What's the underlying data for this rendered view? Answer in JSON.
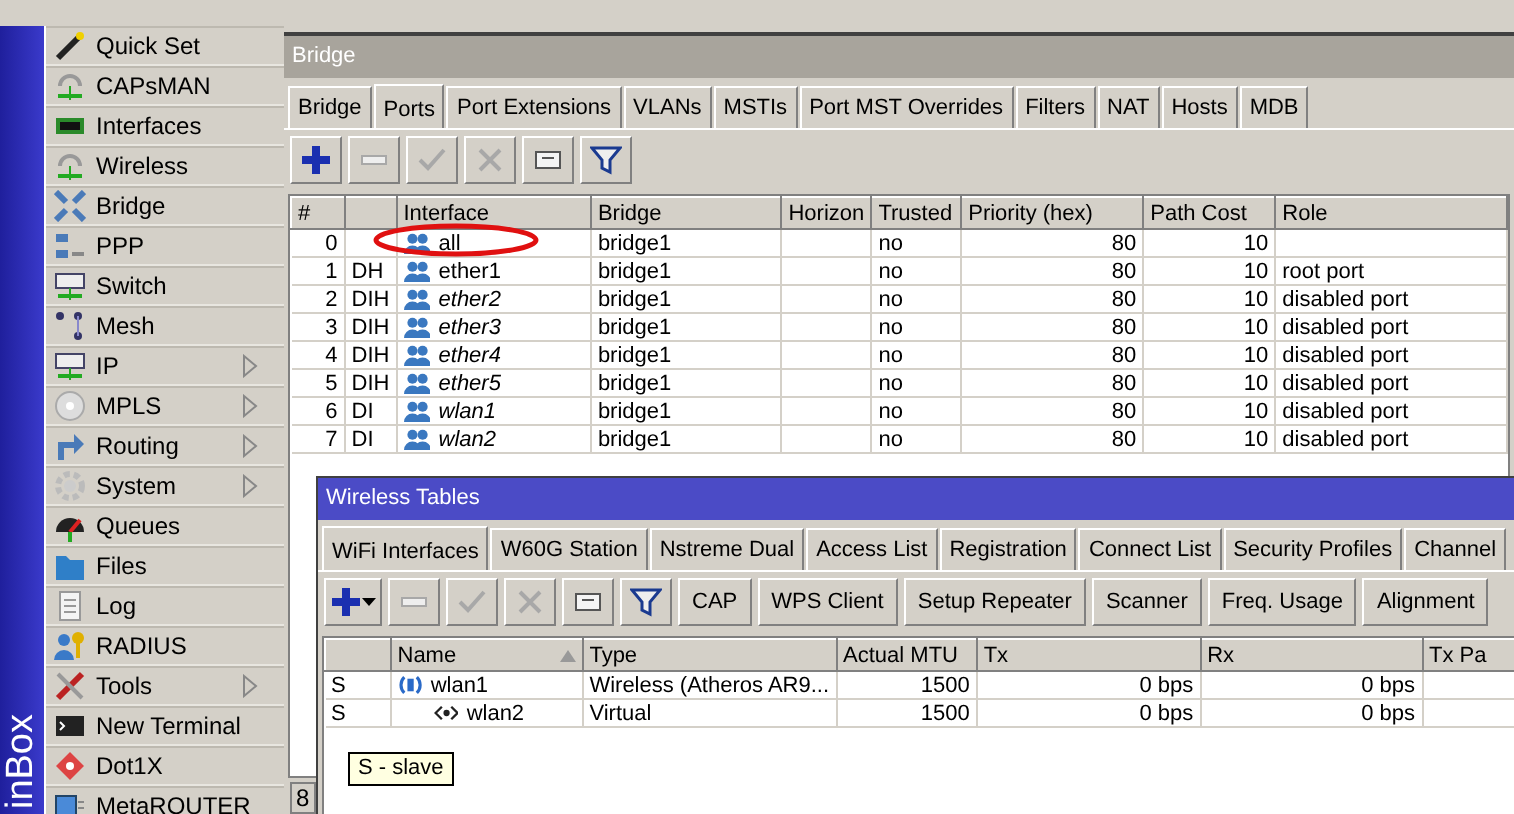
{
  "sidebar": {
    "brand": "inBox",
    "items": [
      {
        "label": "Quick Set",
        "submenu": false
      },
      {
        "label": "CAPsMAN",
        "submenu": false
      },
      {
        "label": "Interfaces",
        "submenu": false
      },
      {
        "label": "Wireless",
        "submenu": false
      },
      {
        "label": "Bridge",
        "submenu": false
      },
      {
        "label": "PPP",
        "submenu": false
      },
      {
        "label": "Switch",
        "submenu": false
      },
      {
        "label": "Mesh",
        "submenu": false
      },
      {
        "label": "IP",
        "submenu": true
      },
      {
        "label": "MPLS",
        "submenu": true
      },
      {
        "label": "Routing",
        "submenu": true
      },
      {
        "label": "System",
        "submenu": true
      },
      {
        "label": "Queues",
        "submenu": false
      },
      {
        "label": "Files",
        "submenu": false
      },
      {
        "label": "Log",
        "submenu": false
      },
      {
        "label": "RADIUS",
        "submenu": false
      },
      {
        "label": "Tools",
        "submenu": true
      },
      {
        "label": "New Terminal",
        "submenu": false
      },
      {
        "label": "Dot1X",
        "submenu": false
      },
      {
        "label": "MetaROUTER",
        "submenu": false
      }
    ]
  },
  "bridge_window": {
    "title": "Bridge",
    "tabs": [
      {
        "label": "Bridge",
        "selected": false
      },
      {
        "label": "Ports",
        "selected": true
      },
      {
        "label": "Port Extensions",
        "selected": false
      },
      {
        "label": "VLANs",
        "selected": false
      },
      {
        "label": "MSTIs",
        "selected": false
      },
      {
        "label": "Port MST Overrides",
        "selected": false
      },
      {
        "label": "Filters",
        "selected": false
      },
      {
        "label": "NAT",
        "selected": false
      },
      {
        "label": "Hosts",
        "selected": false
      },
      {
        "label": "MDB",
        "selected": false
      }
    ],
    "toolbar": [
      {
        "kind": "add",
        "disabled": false
      },
      {
        "kind": "remove",
        "disabled": true
      },
      {
        "kind": "enable",
        "disabled": true
      },
      {
        "kind": "disable",
        "disabled": true
      },
      {
        "kind": "comment",
        "disabled": false
      },
      {
        "kind": "filter",
        "disabled": false
      }
    ],
    "table": {
      "columns": [
        "#",
        "Interface",
        "Bridge",
        "Horizon",
        "Trusted",
        "Priority (hex)",
        "Path Cost",
        "Role"
      ],
      "rows": [
        {
          "number": "0",
          "interface": "all",
          "bridge": "bridge1",
          "trusted": "no",
          "priority": "80",
          "path_cost": "10",
          "disabled": false
        },
        {
          "number": "1",
          "flags": "DH",
          "interface": "ether1",
          "bridge": "bridge1",
          "trusted": "no",
          "priority": "80",
          "path_cost": "10",
          "role": "root port",
          "disabled": false
        },
        {
          "number": "2",
          "flags": "DIH",
          "interface": "ether2",
          "bridge": "bridge1",
          "trusted": "no",
          "priority": "80",
          "path_cost": "10",
          "role": "disabled port",
          "disabled": true
        },
        {
          "number": "3",
          "flags": "DIH",
          "interface": "ether3",
          "bridge": "bridge1",
          "trusted": "no",
          "priority": "80",
          "path_cost": "10",
          "role": "disabled port",
          "disabled": true
        },
        {
          "number": "4",
          "flags": "DIH",
          "interface": "ether4",
          "bridge": "bridge1",
          "trusted": "no",
          "priority": "80",
          "path_cost": "10",
          "role": "disabled port",
          "disabled": true
        },
        {
          "number": "5",
          "flags": "DIH",
          "interface": "ether5",
          "bridge": "bridge1",
          "trusted": "no",
          "priority": "80",
          "path_cost": "10",
          "role": "disabled port",
          "disabled": true
        },
        {
          "number": "6",
          "flags": "DI",
          "interface": "wlan1",
          "bridge": "bridge1",
          "trusted": "no",
          "priority": "80",
          "path_cost": "10",
          "role": "disabled port",
          "disabled": true
        },
        {
          "number": "7",
          "flags": "DI",
          "interface": "wlan2",
          "bridge": "bridge1",
          "trusted": "no",
          "priority": "80",
          "path_cost": "10",
          "role": "disabled port",
          "disabled": true
        }
      ]
    },
    "status": "8"
  },
  "wireless_window": {
    "title": "Wireless Tables",
    "tabs": [
      {
        "label": "WiFi Interfaces",
        "selected": true
      },
      {
        "label": "W60G Station",
        "selected": false
      },
      {
        "label": "Nstreme Dual",
        "selected": false
      },
      {
        "label": "Access List",
        "selected": false
      },
      {
        "label": "Registration",
        "selected": false
      },
      {
        "label": "Connect List",
        "selected": false
      },
      {
        "label": "Security Profiles",
        "selected": false
      },
      {
        "label": "Channel",
        "selected": false
      }
    ],
    "toolbar": [
      {
        "kind": "add",
        "disabled": false,
        "dropdown": true
      },
      {
        "kind": "remove",
        "disabled": true
      },
      {
        "kind": "enable",
        "disabled": true
      },
      {
        "kind": "disable",
        "disabled": true
      },
      {
        "kind": "comment",
        "disabled": false
      },
      {
        "kind": "filter",
        "disabled": false
      }
    ],
    "buttons": [
      "CAP",
      "WPS Client",
      "Setup Repeater",
      "Scanner",
      "Freq. Usage",
      "Alignment"
    ],
    "table": {
      "columns": [
        {
          "label": "Name",
          "sorted": true
        },
        {
          "label": "Type",
          "sorted": false
        },
        {
          "label": "Actual MTU",
          "sorted": false
        },
        {
          "label": "Tx",
          "sorted": false
        },
        {
          "label": "Rx",
          "sorted": false
        },
        {
          "label": "Tx Pa",
          "sorted": false
        }
      ],
      "rows": [
        {
          "flags": "S",
          "kind": "wireless",
          "name": "wlan1",
          "type": "Wireless (Atheros AR9...",
          "mtu": "1500",
          "tx": "0 bps",
          "rx": "0 bps",
          "children": [
            {
              "flags": "S",
              "kind": "virtual",
              "name": "wlan2",
              "type": "Virtual",
              "mtu": "1500",
              "tx": "0 bps",
              "rx": "0 bps"
            }
          ]
        }
      ]
    },
    "tooltip": "S - slave"
  }
}
